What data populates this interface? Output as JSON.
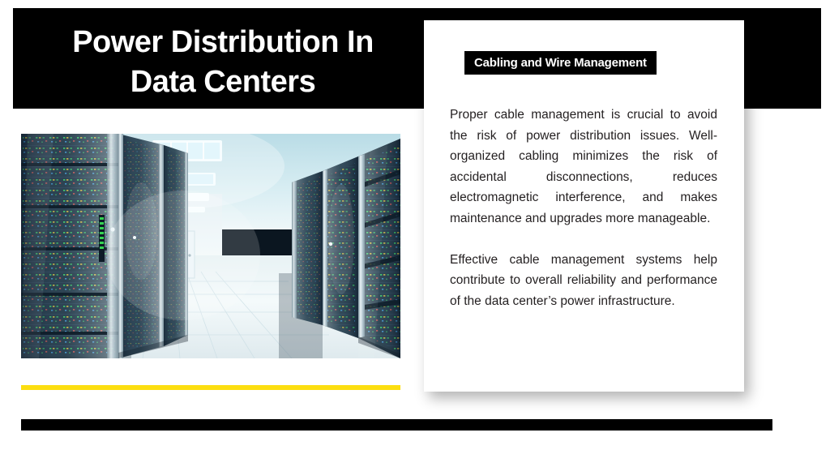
{
  "slide": {
    "header": {
      "title": "Power Distribution In\nData Centers"
    },
    "media": {
      "photo_alt": "data-center-server-room-aisle",
      "photo_description": "Rows of glass-front server racks with blue, green, red and amber status LEDs lining a bright white corridor with ceiling light panels, a green exit sign, a closed door and a reflective tiled floor."
    },
    "card": {
      "badge_label": "Cabling and Wire Management",
      "paragraphs": [
        "Proper cable management is crucial to avoid the risk of power distribution issues. Well-organized cabling minimizes the risk of accidental disconnections, reduces electromagnetic interference, and makes maintenance and upgrades more manageable.",
        "Effective cable management systems help contribute to overall reliability and performance of the data center’s power infrastructure."
      ]
    },
    "decor": {
      "yellow_rule_color": "#fcde10",
      "bottom_rule_color": "#000000",
      "header_bar_color": "#000000",
      "card_background": "#ffffff",
      "body_text_color": "#231f20"
    }
  }
}
